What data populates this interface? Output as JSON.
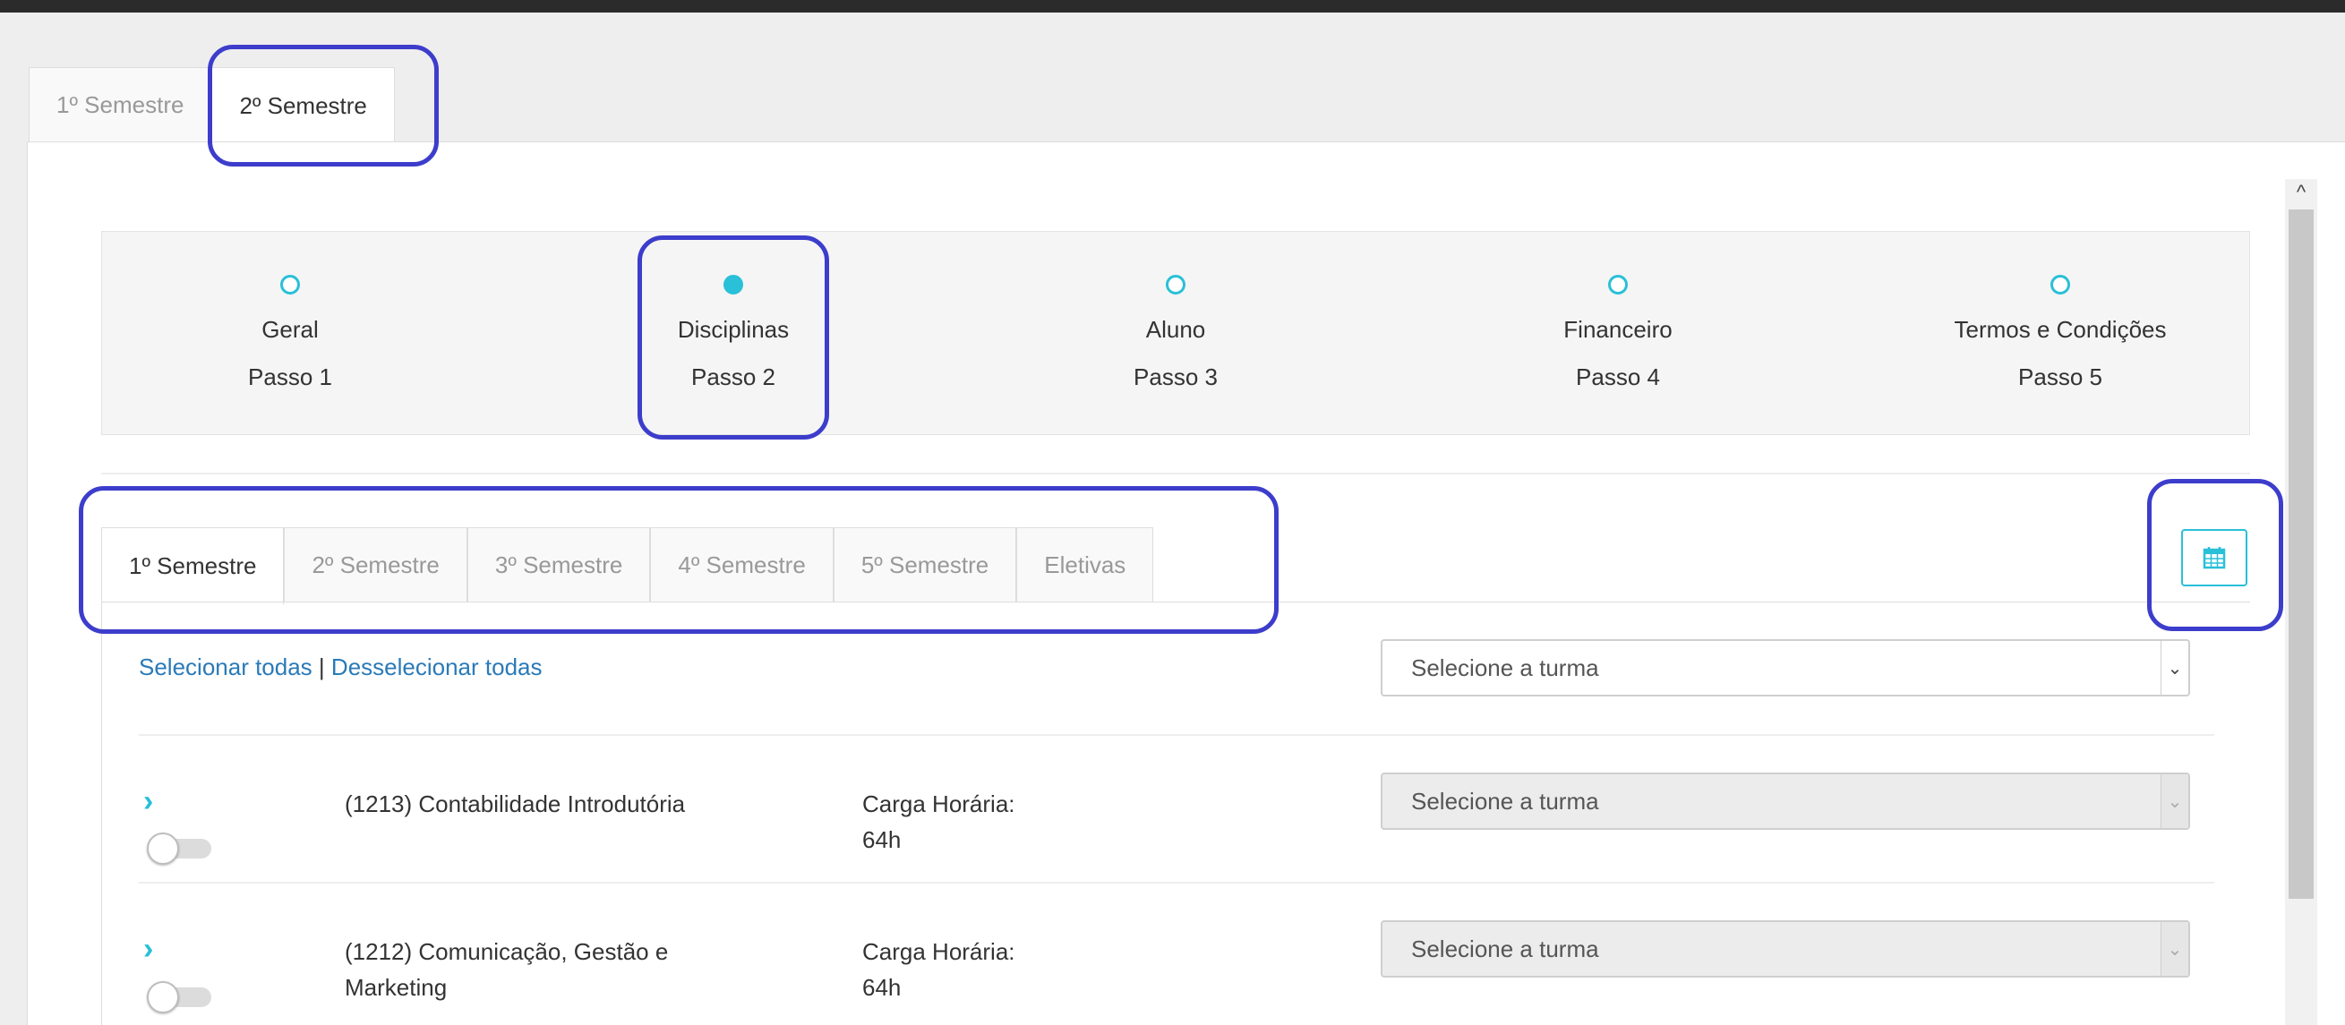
{
  "outer_tabs": [
    "1º Semestre",
    "2º Semestre"
  ],
  "outer_active": "2º Semestre",
  "steps": [
    {
      "name": "Geral",
      "step": "Passo 1",
      "active": false
    },
    {
      "name": "Disciplinas",
      "step": "Passo 2",
      "active": true
    },
    {
      "name": "Aluno",
      "step": "Passo 3",
      "active": false
    },
    {
      "name": "Financeiro",
      "step": "Passo 4",
      "active": false
    },
    {
      "name": "Termos e Condições",
      "step": "Passo 5",
      "active": false
    }
  ],
  "semester_tabs": [
    "1º Semestre",
    "2º Semestre",
    "3º Semestre",
    "4º Semestre",
    "5º Semestre",
    "Eletivas"
  ],
  "semester_active": "1º Semestre",
  "select_all": "Selecionar todas",
  "separator": "|",
  "deselect_all": "Desselecionar todas",
  "class_select_placeholder": "Selecione a turma",
  "courses": [
    {
      "name": "(1213) Contabilidade Introdutória",
      "load_label": "Carga Horária:",
      "load": "64h",
      "select": "Selecione a turma",
      "enabled": false
    },
    {
      "name": "(1212) Comunicação, Gestão e Marketing",
      "load_label": "Carga Horária:",
      "load": "64h",
      "select": "Selecione a turma",
      "enabled": false
    }
  ],
  "icons": {
    "calendar": "calendar-icon",
    "expand": "chevron-right-icon",
    "scroll_up": "chevron-up-icon",
    "dropdown": "chevron-down-icon"
  },
  "colors": {
    "accent": "#29c0d8",
    "link": "#2a7ab8",
    "highlight": "#3d3dcc"
  }
}
